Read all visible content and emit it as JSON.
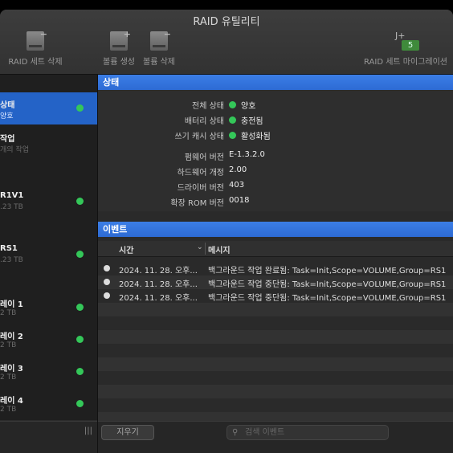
{
  "window": {
    "title": "RAID 유틸리티"
  },
  "toolbar": {
    "delete_raid_set": "RAID 세트 삭제",
    "create_volume": "볼륨 생성",
    "delete_volume": "볼륨 삭제",
    "raid_migration": "RAID 세트 마이그레이션",
    "migration_badge": "5"
  },
  "sidebar": {
    "items": [
      {
        "line1": "상태",
        "line2": "양호",
        "status": "green",
        "selected": true
      },
      {
        "line1": "작업",
        "line2": "개의 작업",
        "status": "",
        "selected": false
      },
      {
        "line1": "R1V1",
        "line2": ".23 TB",
        "status": "green",
        "selected": false
      },
      {
        "line1": "RS1",
        "line2": ".23 TB",
        "status": "green",
        "selected": false
      },
      {
        "line1": "레이 1",
        "line2": "2 TB",
        "status": "green",
        "selected": false
      },
      {
        "line1": "레이 2",
        "line2": "2 TB",
        "status": "green",
        "selected": false
      },
      {
        "line1": "레이 3",
        "line2": "2 TB",
        "status": "green",
        "selected": false
      },
      {
        "line1": "레이 4",
        "line2": "2 TB",
        "status": "green",
        "selected": false
      }
    ]
  },
  "status_section": {
    "header": "상태",
    "overall_label": "전체 상태",
    "overall_value": "양호",
    "battery_label": "배터리 상태",
    "battery_value": "충전됨",
    "cache_label": "쓰기 캐시 상태",
    "cache_value": "활성화됨",
    "firmware_label": "펌웨어 버전",
    "firmware_value": "E-1.3.2.0",
    "hardware_label": "하드웨어 개정",
    "hardware_value": "2.00",
    "driver_label": "드라이버 버전",
    "driver_value": "403",
    "rom_label": "확장 ROM 버전",
    "rom_value": "0018"
  },
  "events_section": {
    "header": "이벤트",
    "col_time": "시간",
    "col_message": "메시지",
    "rows": [
      {
        "time": "2024. 11. 28. 오후...",
        "message": "백그라운드 작업 완료됨: Task=Init,Scope=VOLUME,Group=RS1"
      },
      {
        "time": "2024. 11. 28. 오후...",
        "message": "백그라운드 작업 중단됨: Task=Init,Scope=VOLUME,Group=RS1"
      },
      {
        "time": "2024. 11. 28. 오후...",
        "message": "백그라운드 작업 중단됨: Task=Init,Scope=VOLUME,Group=RS1"
      }
    ]
  },
  "footer": {
    "clear_label": "지우기",
    "search_placeholder": "검색 이벤트"
  },
  "colors": {
    "accent": "#2d6bd4",
    "ok": "#34c759"
  }
}
